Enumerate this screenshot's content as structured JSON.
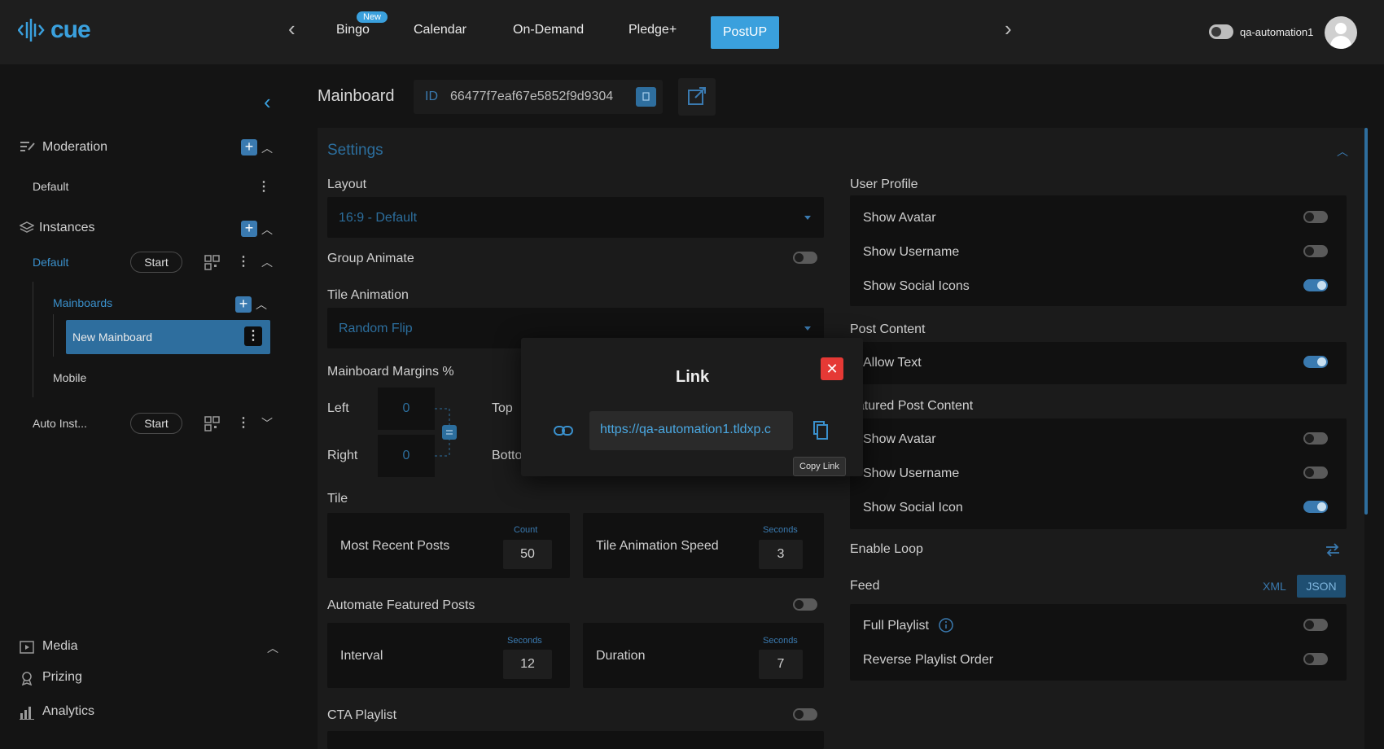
{
  "topbar": {
    "logo_text": "cue",
    "nav": [
      {
        "label": "Bingo",
        "badge": "New"
      },
      {
        "label": "Calendar"
      },
      {
        "label": "On-Demand"
      },
      {
        "label": "Pledge+"
      },
      {
        "label": "PostUP",
        "active": true
      }
    ],
    "username": "qa-automation1"
  },
  "sidebar": {
    "moderation": {
      "label": "Moderation",
      "items": [
        "Default"
      ]
    },
    "instances": {
      "label": "Instances",
      "default": {
        "label": "Default",
        "start_label": "Start"
      },
      "mainboards": {
        "label": "Mainboards",
        "items": [
          "New Mainboard"
        ]
      },
      "mobile": "Mobile",
      "auto": {
        "label": "Auto Inst...",
        "start_label": "Start"
      }
    },
    "bottom": [
      {
        "label": "Media",
        "icon": "media-icon"
      },
      {
        "label": "Prizing",
        "icon": "prizing-icon"
      },
      {
        "label": "Analytics",
        "icon": "analytics-icon"
      }
    ]
  },
  "main": {
    "title": "Mainboard",
    "id_label": "ID",
    "id_value": "66477f7eaf67e5852f9d9304",
    "settings_title": "Settings",
    "layout": {
      "label": "Layout",
      "value": "16:9 - Default"
    },
    "group_animate": {
      "label": "Group Animate",
      "on": false
    },
    "tile_animation": {
      "label": "Tile Animation",
      "value": "Random Flip"
    },
    "margins": {
      "label": "Mainboard Margins %",
      "left_label": "Left",
      "left": "0",
      "right_label": "Right",
      "right": "0",
      "top_label": "Top",
      "bottom_label": "Botto"
    },
    "tile": {
      "label": "Tile",
      "most_recent": {
        "label": "Most Recent Posts",
        "unit": "Count",
        "value": "50"
      },
      "anim_speed": {
        "label": "Tile Animation Speed",
        "unit": "Seconds",
        "value": "3"
      }
    },
    "automate": {
      "label": "Automate Featured Posts",
      "on": false,
      "interval": {
        "label": "Interval",
        "unit": "Seconds",
        "value": "12"
      },
      "duration": {
        "label": "Duration",
        "unit": "Seconds",
        "value": "7"
      }
    },
    "cta": {
      "label": "CTA Playlist",
      "on": false
    },
    "user_profile": {
      "label": "User Profile",
      "items": [
        {
          "label": "Show Avatar",
          "on": false
        },
        {
          "label": "Show Username",
          "on": false
        },
        {
          "label": "Show Social Icons",
          "on": true
        }
      ]
    },
    "post_content": {
      "label": "Post Content",
      "items": [
        {
          "label": "Allow Text",
          "on": true
        }
      ]
    },
    "featured_content": {
      "label": "eatured Post Content",
      "items": [
        {
          "label": "Show Avatar",
          "on": false
        },
        {
          "label": "Show Username",
          "on": false
        },
        {
          "label": "Show Social Icon",
          "on": true
        }
      ]
    },
    "enable_loop": "Enable Loop",
    "feed": {
      "label": "Feed",
      "xml": "XML",
      "json": "JSON",
      "items": [
        {
          "label": "Full Playlist",
          "on": false
        },
        {
          "label": "Reverse Playlist Order",
          "on": false
        }
      ]
    }
  },
  "modal": {
    "title": "Link",
    "url": "https://qa-automation1.tldxp.c",
    "tooltip": "Copy Link"
  },
  "colors": {
    "accent": "#3aa0dd",
    "danger": "#e53935",
    "bg": "#141414"
  }
}
